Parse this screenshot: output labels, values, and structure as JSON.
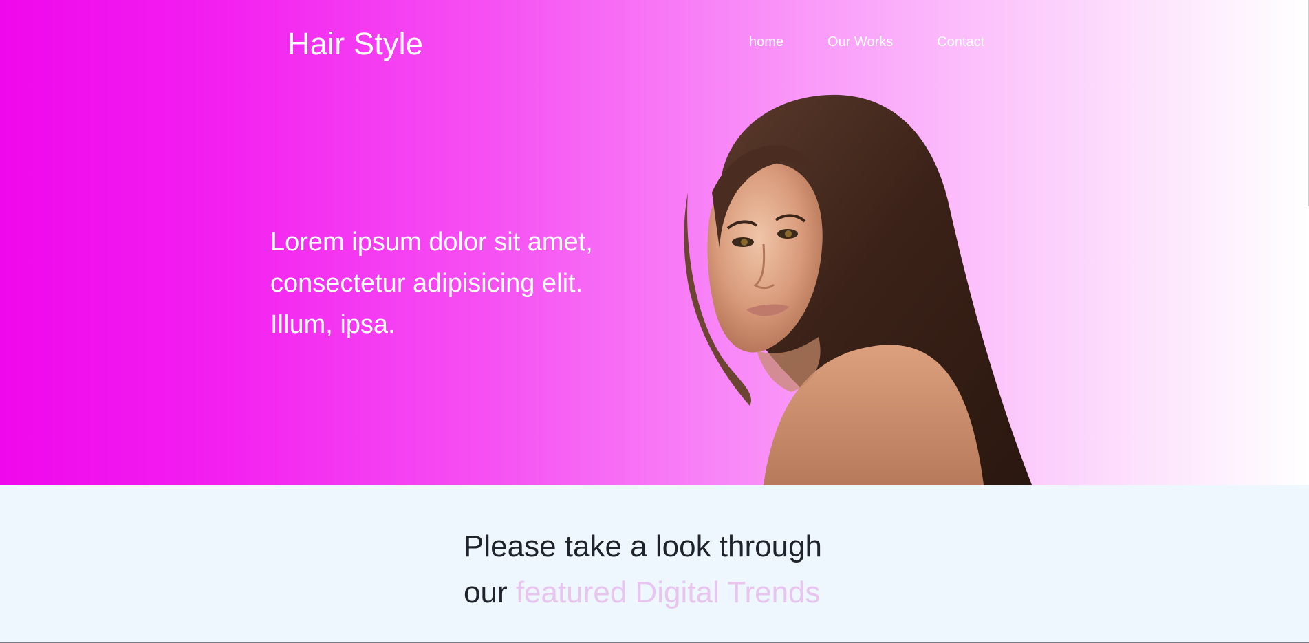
{
  "header": {
    "brand": "Hair Style",
    "nav": [
      "home",
      "Our Works",
      "Contact"
    ]
  },
  "hero": {
    "lines": [
      "Lorem ipsum dolor sit amet,",
      "consectetur adipisicing elit.",
      "Illum, ipsa."
    ]
  },
  "featured": {
    "line1": "Please take a look through",
    "line2_prefix": "our ",
    "line2_accent": "featured Digital Trends"
  },
  "colors": {
    "gradient_start": "#ef08ec",
    "gradient_end": "#ffffff",
    "accent_text": "#e7c5ee",
    "section_bg": "#eef6fe",
    "heading_text": "#1f232a"
  }
}
